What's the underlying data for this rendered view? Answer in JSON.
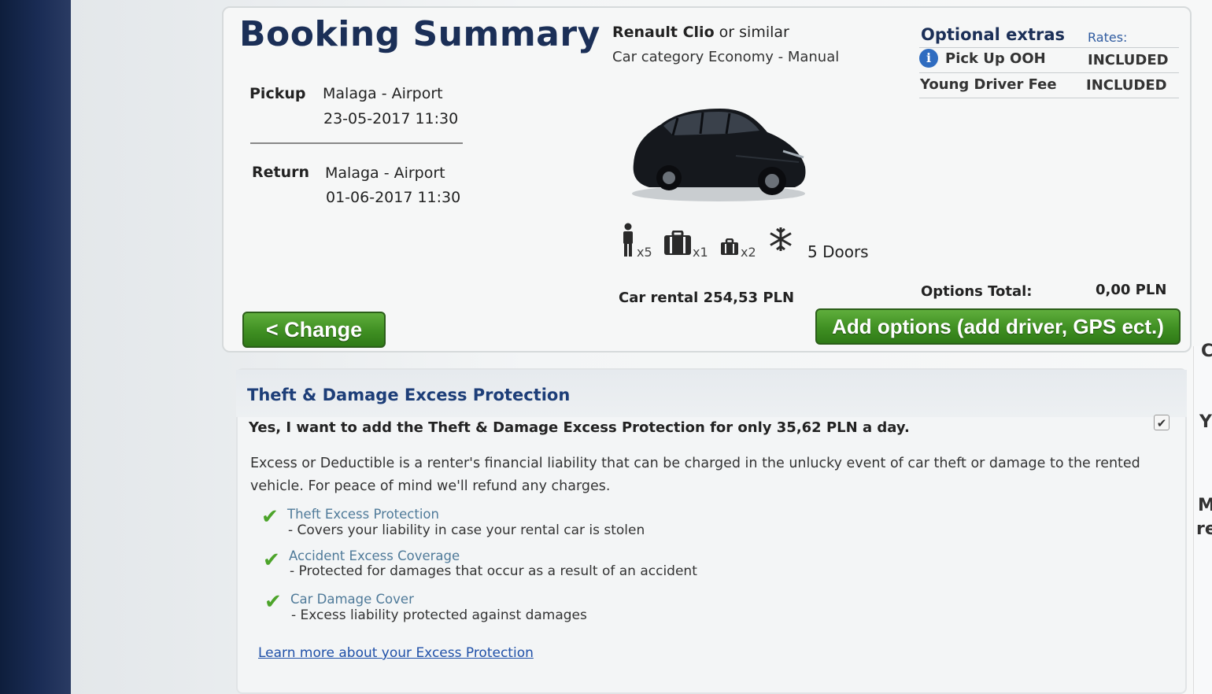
{
  "summary": {
    "title": "Booking Summary",
    "pickup_label": "Pickup",
    "pickup_location": "Malaga - Airport",
    "pickup_datetime": "23-05-2017 11:30",
    "return_label": "Return",
    "return_location": "Malaga - Airport",
    "return_datetime": "01-06-2017 11:30"
  },
  "car": {
    "name": "Renault Clio",
    "or_similar": "or similar",
    "category": "Car category Economy - Manual",
    "passengers": "x5",
    "large_bags": "x1",
    "small_bags": "x2",
    "doors": "5 Doors",
    "rental_total": "Car rental 254,53 PLN"
  },
  "extras": {
    "heading": "Optional extras",
    "rates_label": "Rates:",
    "items": [
      {
        "label": "Pick Up OOH",
        "rate": "INCLUDED"
      },
      {
        "label": "Young Driver Fee",
        "rate": "INCLUDED"
      }
    ],
    "options_total_label": "Options Total:",
    "options_total_value": "0,00 PLN"
  },
  "buttons": {
    "change": "< Change",
    "add_options": "Add options (add driver, GPS ect.)"
  },
  "protection": {
    "title": "Theft & Damage Excess Protection",
    "offer": "Yes, I want to add the Theft & Damage Excess Protection for only 35,62 PLN a day.",
    "checked": true,
    "checkmark": "✔",
    "desc_line1": "Excess or Deductible is a renter's financial liability that can be charged in the unlucky event of car theft or damage to the rented",
    "desc_line2": "vehicle. For peace of mind we'll refund any charges.",
    "bullets": [
      {
        "title": "Theft Excess Protection",
        "desc": "- Covers your liability in case your rental car is stolen"
      },
      {
        "title": "Accident Excess Coverage",
        "desc": "- Protected for damages that occur as a result of an accident"
      },
      {
        "title": "Car Damage Cover",
        "desc": "- Excess liability protected against damages"
      }
    ],
    "learn_more": "Learn more about your Excess Protection"
  },
  "side": {
    "c": "C",
    "y": "Y",
    "m": "M",
    "re": "re"
  },
  "colors": {
    "title_navy": "#1b2f57",
    "button_green": "#3f8f22",
    "link_blue": "#1f50a8",
    "check_green": "#4ca42a"
  },
  "icons": {
    "info": "info-icon",
    "person": "person-icon",
    "large_suitcase": "large-suitcase-icon",
    "small_suitcase": "small-suitcase-icon",
    "air_conditioning": "snowflake-icon",
    "bullet": "green-check-icon"
  }
}
